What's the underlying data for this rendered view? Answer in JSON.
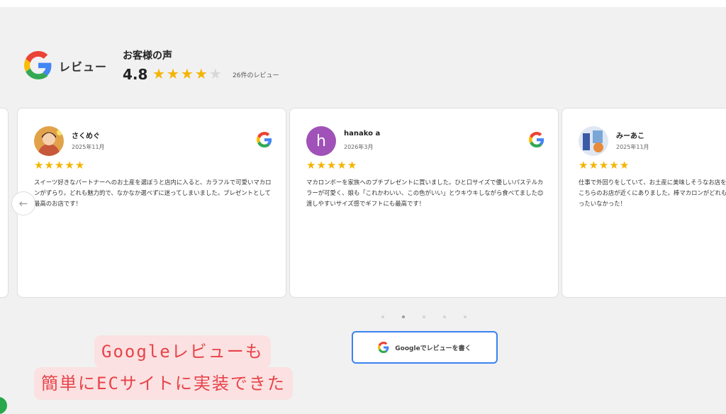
{
  "widget": {
    "brand_label": "レビュー",
    "title": "お客様の声",
    "rating": "4.8",
    "stars_filled": 4,
    "stars_total": 5,
    "review_count": "26件のレビュー"
  },
  "reviews": [
    {
      "name": "さくめぐ",
      "date": "2025年11月",
      "stars": 5,
      "text": "スイーツ好きなパートナーへのお土産を選ぼうと店内に入ると、カラフルで可愛いマカロンがずらり。どれも魅力的で、なかなか選べずに迷ってしまいました。プレゼントとして最高のお店です！"
    },
    {
      "name": "hanako a",
      "avatar_initial": "h",
      "date": "2026年3月",
      "stars": 5,
      "text": "マカロンボーを家族へのプチプレゼントに買いました。ひと口サイズで優しいパステルカラーが可愛く、娘も「これかわいい、この色がいい」とウキウキしながら食べてました😊渡しやすいサイズ感でギフトにも最高です！"
    },
    {
      "name": "みーあこ",
      "date": "2025年11月",
      "stars": 5,
      "text": "仕事で外回りをしていて、お土産に美味しそうなお店をGoogleマップで探していた所、こちらのお店が近くにありました。棒マカロンがどれも可愛くて迷ってしまいました。もったいなかった！"
    }
  ],
  "carousel": {
    "prev_arrow": "←",
    "dots": 5,
    "active_dot": 1
  },
  "write_review_label": "Googleでレビューを書く",
  "captions": {
    "line1": "Googleレビューも",
    "line2": "簡単にECサイトに実装できた"
  },
  "colors": {
    "star": "#f5b400",
    "accent_blue": "#3a82f0",
    "caption_red": "#e8434a",
    "caption_bg": "#fbe1e1"
  }
}
